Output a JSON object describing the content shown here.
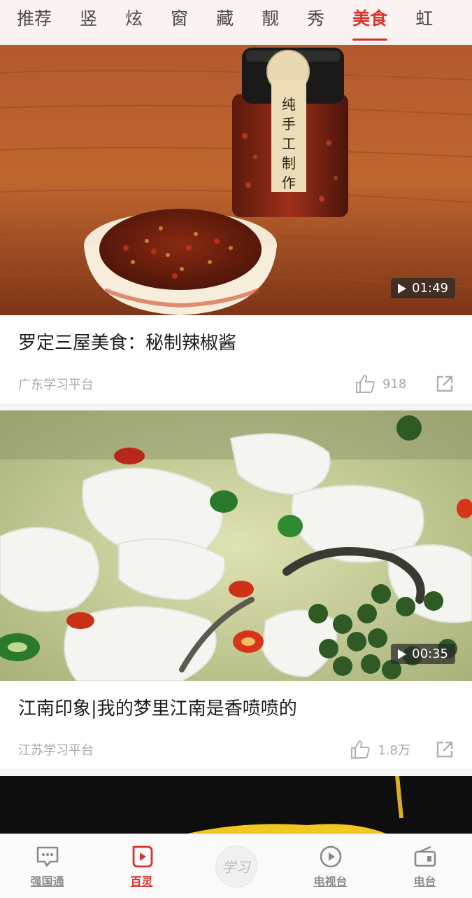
{
  "tabs": [
    {
      "label": "推荐",
      "active": false
    },
    {
      "label": "竖",
      "active": false
    },
    {
      "label": "炫",
      "active": false
    },
    {
      "label": "窗",
      "active": false
    },
    {
      "label": "藏",
      "active": false
    },
    {
      "label": "靓",
      "active": false
    },
    {
      "label": "秀",
      "active": false
    },
    {
      "label": "美食",
      "active": true
    },
    {
      "label": "虹",
      "active": false
    }
  ],
  "cards": [
    {
      "thumbnail": "chili-sauce-jar-and-bowl",
      "jar_label": "纯手工制作",
      "duration": "01:49",
      "title": "罗定三屋美食：秘制辣椒酱",
      "source": "广东学习平台",
      "likes": "918"
    },
    {
      "thumbnail": "fish-soup-with-peppercorns",
      "duration": "00:35",
      "title": "江南印象|我的梦里江南是香喷喷的",
      "source": "江苏学习平台",
      "likes": "1.8万"
    },
    {
      "thumbnail": "dark-food-image-partial"
    }
  ],
  "bottom_nav": [
    {
      "label": "强国通",
      "icon": "chat-icon",
      "active": false
    },
    {
      "label": "百灵",
      "icon": "play-card-icon",
      "active": true
    },
    {
      "label": "学习",
      "icon": "xuexi-logo",
      "active": false
    },
    {
      "label": "电视台",
      "icon": "play-circle-icon",
      "active": false
    },
    {
      "label": "电台",
      "icon": "radio-icon",
      "active": false
    }
  ],
  "colors": {
    "accent": "#d8322b",
    "tab_bar_bg": "#faf3f2",
    "muted_text": "#a8a8a8"
  }
}
